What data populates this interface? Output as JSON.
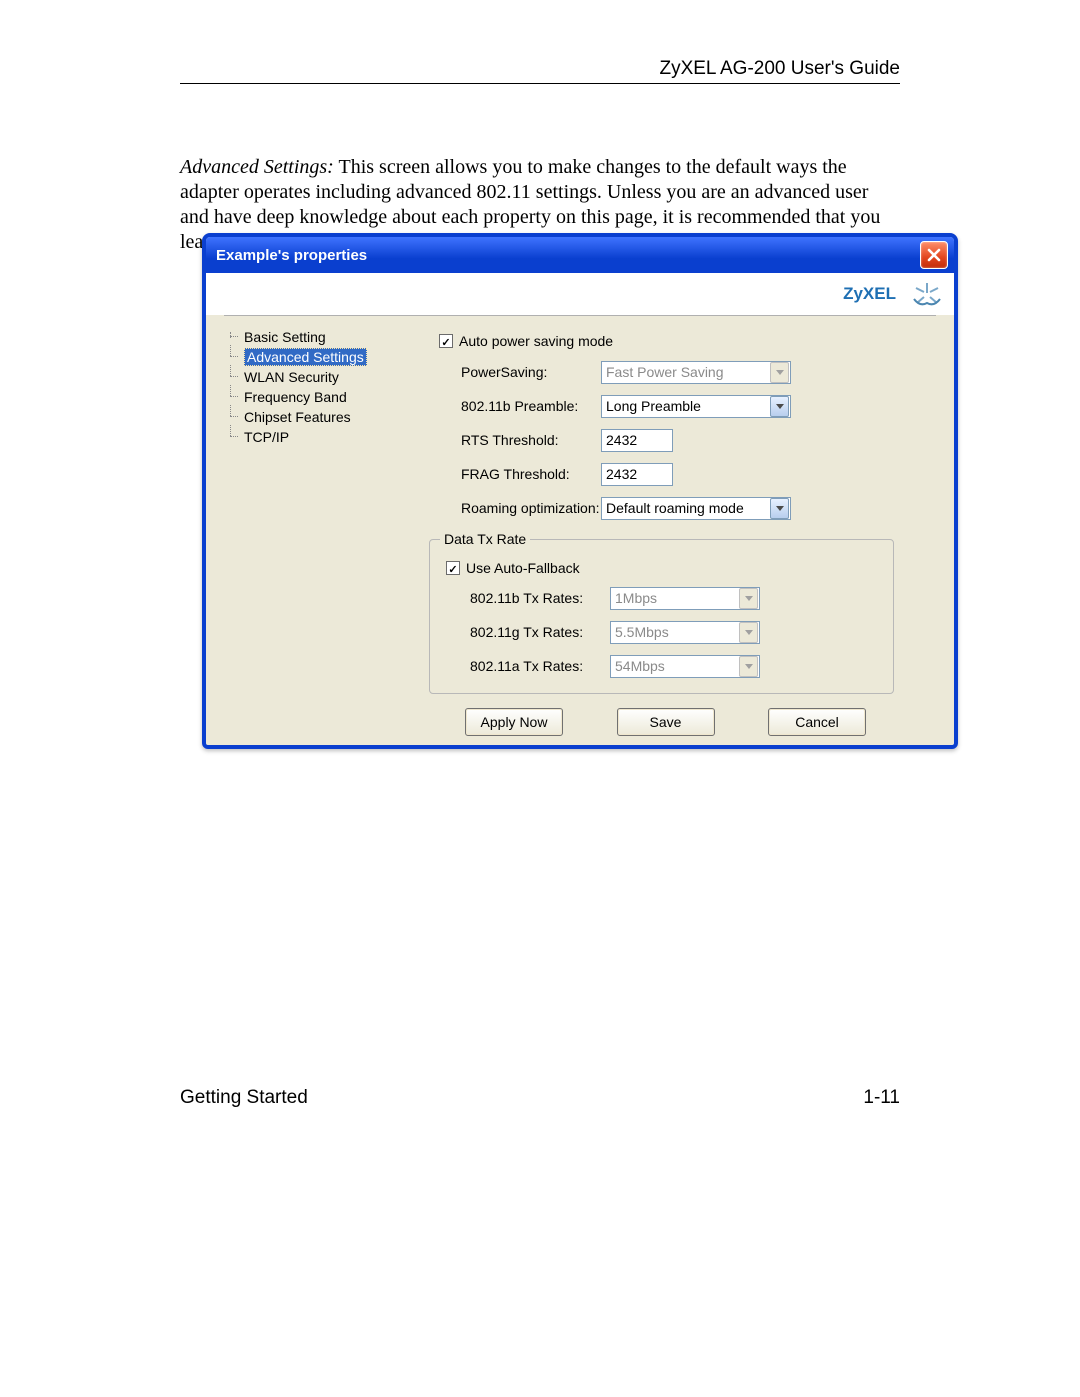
{
  "doc": {
    "header": "ZyXEL AG-200 User's Guide",
    "para_lead": "Advanced Settings:",
    "para_body": " This screen allows you to make changes to the default ways the adapter operates including advanced 802.11 settings.  Unless you are an advanced user and have deep knowledge about each property on  this page, it is recommended that you leave them at the default settings.",
    "footer_left": "Getting Started",
    "footer_right": "1-11"
  },
  "dialog": {
    "title": "Example's properties",
    "brand": "ZyXEL",
    "tree": {
      "items": [
        {
          "label": "Basic Setting",
          "selected": false
        },
        {
          "label": "Advanced Settings",
          "selected": true
        },
        {
          "label": "WLAN Security",
          "selected": false
        },
        {
          "label": "Frequency Band",
          "selected": false
        },
        {
          "label": "Chipset Features",
          "selected": false
        },
        {
          "label": "TCP/IP",
          "selected": false
        }
      ]
    },
    "auto_power_label": "Auto power saving mode",
    "auto_power_checked": true,
    "power_saving": {
      "label": "PowerSaving:",
      "value": "Fast Power Saving",
      "disabled": true
    },
    "preamble": {
      "label": "802.11b Preamble:",
      "value": "Long Preamble",
      "disabled": false
    },
    "rts": {
      "label": "RTS Threshold:",
      "value": "2432"
    },
    "frag": {
      "label": "FRAG Threshold:",
      "value": "2432"
    },
    "roaming": {
      "label": "Roaming optimization:",
      "value": "Default roaming mode",
      "disabled": false
    },
    "tx_group_title": "Data Tx Rate",
    "auto_fallback_label": "Use Auto-Fallback",
    "auto_fallback_checked": true,
    "tx_b": {
      "label": "802.11b Tx Rates:",
      "value": "1Mbps",
      "disabled": true
    },
    "tx_g": {
      "label": "802.11g Tx Rates:",
      "value": "5.5Mbps",
      "disabled": true
    },
    "tx_a": {
      "label": "802.11a Tx Rates:",
      "value": "54Mbps",
      "disabled": true
    },
    "buttons": {
      "apply": "Apply Now",
      "save": "Save",
      "cancel": "Cancel"
    }
  }
}
